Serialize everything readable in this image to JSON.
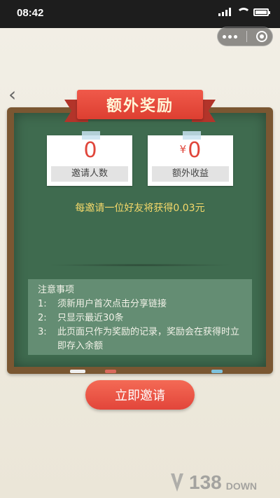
{
  "status_bar": {
    "time": "08:42"
  },
  "banner": {
    "title": "额外奖励"
  },
  "stats": [
    {
      "value": "0",
      "currency": "",
      "label": "邀请人数"
    },
    {
      "value": "0",
      "currency": "¥",
      "label": "额外收益"
    }
  ],
  "reward_note": "每邀请一位好友将获得0.03元",
  "notice": {
    "title": "注意事项",
    "items": [
      {
        "num": "1:",
        "text": "须新用户首次点击分享链接"
      },
      {
        "num": "2:",
        "text": "只显示最近30条"
      },
      {
        "num": "3:",
        "text": "此页面只作为奖励的记录，奖励会在获得时立即存入余额"
      }
    ]
  },
  "invite_button": {
    "label": "立即邀请"
  },
  "watermark": {
    "num": "138",
    "word": "DOWN"
  },
  "colors": {
    "accent_red": "#e2453a",
    "board_green": "#3f6b4f",
    "board_frame": "#7a5732",
    "highlight_yellow": "#f5d96a"
  },
  "icons": [
    "signal-icon",
    "wifi-icon",
    "battery-icon",
    "more-dots-icon",
    "close-target-icon",
    "back-arrow-icon"
  ]
}
